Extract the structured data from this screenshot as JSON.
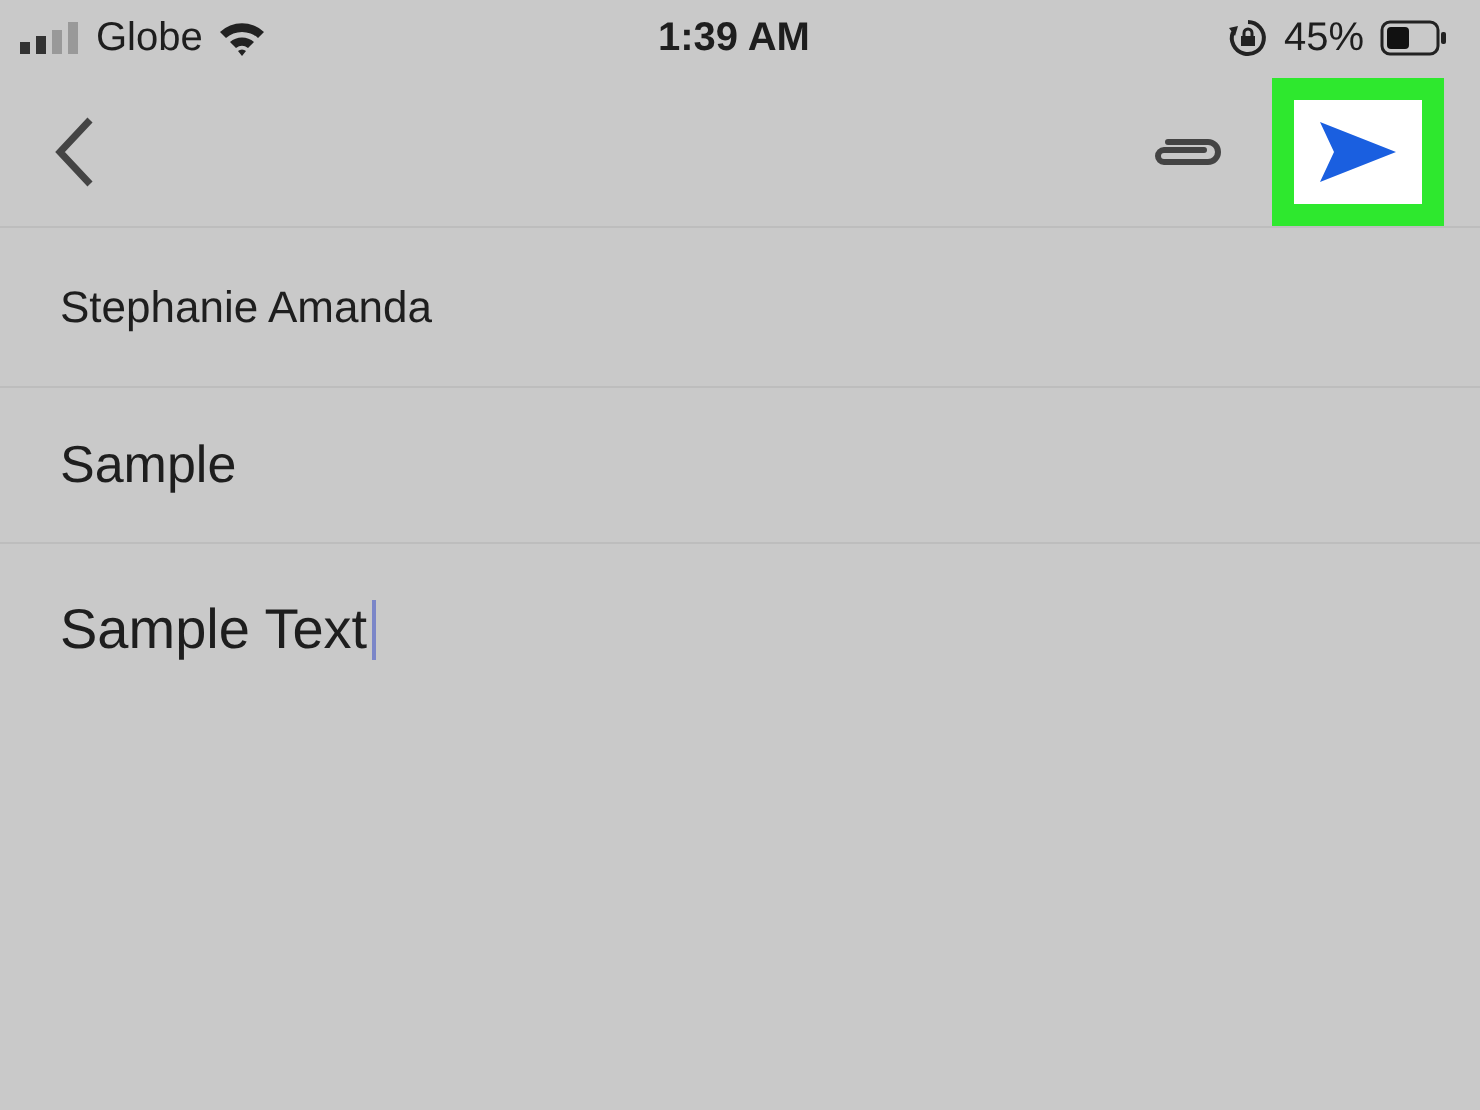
{
  "status_bar": {
    "carrier": "Globe",
    "time": "1:39 AM",
    "battery_percent": "45%"
  },
  "toolbar": {
    "send_highlighted": true
  },
  "fields": [
    {
      "kind": "recipient",
      "value": "Stephanie Amanda",
      "focused": false
    },
    {
      "kind": "subject",
      "value": "Sample",
      "focused": false
    },
    {
      "kind": "body",
      "value": "Sample Text",
      "focused": true
    }
  ]
}
